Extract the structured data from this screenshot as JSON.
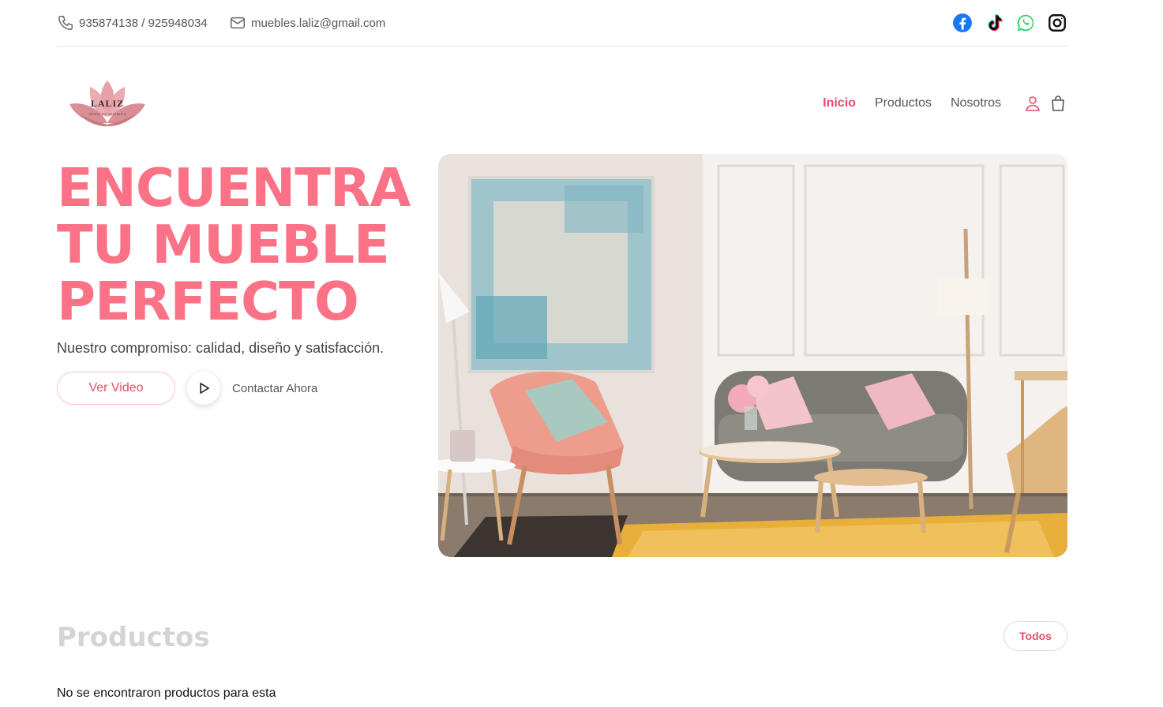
{
  "topbar": {
    "phone": "935874138 / 925948034",
    "email": "muebles.laliz@gmail.com",
    "socials": [
      "facebook-icon",
      "tiktok-icon",
      "whatsapp-icon",
      "instagram-icon"
    ]
  },
  "logo": {
    "name": "LALIZ",
    "tagline": "VENTA DE MUEBLES"
  },
  "nav": {
    "items": [
      {
        "label": "Inicio",
        "active": true
      },
      {
        "label": "Productos",
        "active": false
      },
      {
        "label": "Nosotros",
        "active": false
      }
    ],
    "icons": [
      "user-icon",
      "shopping-bag-icon"
    ]
  },
  "hero": {
    "title_lines": [
      "ENCUENTRA",
      "TU MUEBLE",
      "PERFECTO"
    ],
    "subtitle": "Nuestro compromiso: calidad, diseño y satisfacción.",
    "video_button": "Ver Video",
    "contact_button": "Contactar Ahora"
  },
  "products": {
    "title": "Productos",
    "filter_button": "Todos",
    "empty_message": "No se encontraron productos para esta"
  },
  "colors": {
    "accent": "#fb7185",
    "accent_dark": "#e94b6a",
    "muted_title": "#d4d4d4"
  }
}
